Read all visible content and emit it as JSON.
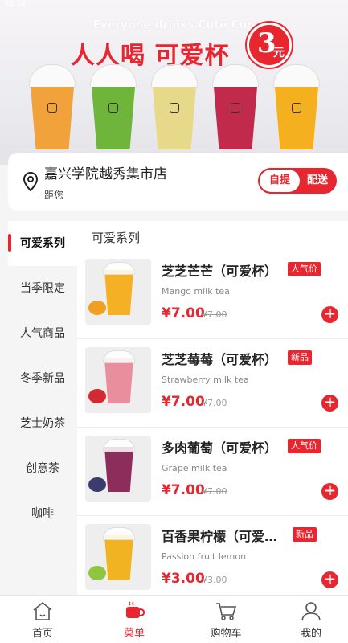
{
  "status": {
    "time": "11:58"
  },
  "banner": {
    "tagline_en": "Everyone drinks Cute Cup",
    "tagline_cn": "人人喝 可爱杯",
    "price_number": "3",
    "price_unit": "元",
    "cup_colors": [
      "#f2a23a",
      "#6fb43b",
      "#e6d98a",
      "#c22a4c",
      "#f4b01e"
    ]
  },
  "store": {
    "name": "嘉兴学院越秀集市店",
    "distance_label": "距您",
    "mode_pickup": "自提",
    "mode_delivery": "配送",
    "selected_mode": "自提"
  },
  "sidebar": {
    "categories": [
      {
        "label": "可爱系列",
        "active": true
      },
      {
        "label": "当季限定",
        "active": false
      },
      {
        "label": "人气商品",
        "active": false
      },
      {
        "label": "冬季新品",
        "active": false
      },
      {
        "label": "芝士奶茶",
        "active": false
      },
      {
        "label": "创意茶",
        "active": false
      },
      {
        "label": "咖啡",
        "active": false
      }
    ]
  },
  "main": {
    "section_title": "可爱系列",
    "products": [
      {
        "name": "芝芝芒芒（可爱杯）",
        "tag": "人气价",
        "name_en": "Mango milk tea",
        "price": "¥7.00",
        "old_price": "¥7.00",
        "drink_color": "#f6b025",
        "fruit_color": "#f0a020"
      },
      {
        "name": "芝芝莓莓（可爱杯）",
        "tag": "新品",
        "name_en": "Strawberry milk tea",
        "price": "¥7.00",
        "old_price": "¥7.00",
        "drink_color": "#e98e9c",
        "fruit_color": "#d22a33"
      },
      {
        "name": "多肉葡萄（可爱杯）",
        "tag": "人气价",
        "name_en": "Grape milk tea",
        "price": "¥7.00",
        "old_price": "¥7.00",
        "drink_color": "#8d2d5c",
        "fruit_color": "#3b3c6e"
      },
      {
        "name": "百香果柠檬（可爱杯）",
        "tag": "新品",
        "name_en": "Passion fruit lemon",
        "price": "¥3.00",
        "old_price": "¥3.00",
        "drink_color": "#f2b323",
        "fruit_color": "#8ec63f"
      }
    ],
    "add_symbol": "+"
  },
  "bottom_nav": {
    "items": [
      {
        "label": "首页",
        "icon": "home-icon",
        "active": false
      },
      {
        "label": "菜单",
        "icon": "menu-cup-icon",
        "active": true
      },
      {
        "label": "购物车",
        "icon": "cart-icon",
        "active": false
      },
      {
        "label": "我的",
        "icon": "user-icon",
        "active": false
      }
    ]
  },
  "colors": {
    "accent": "#e8262f"
  }
}
